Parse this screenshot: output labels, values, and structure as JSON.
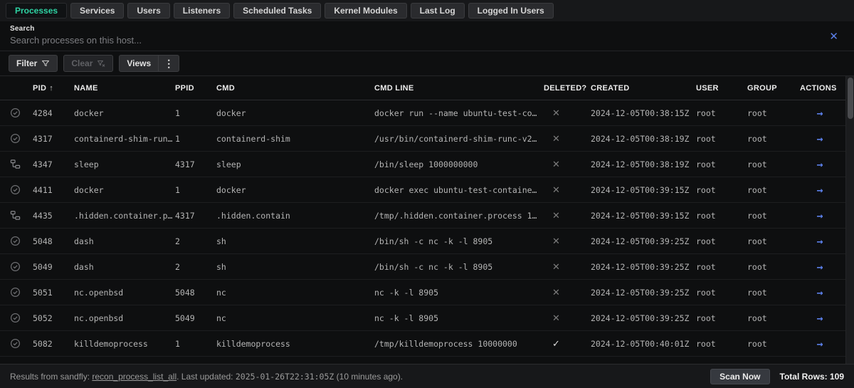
{
  "colors": {
    "accent_teal": "#2ed3a3",
    "accent_blue": "#5b7fe8",
    "background": "#0e0f10"
  },
  "icons": {
    "close": "✕",
    "kebab": "⋮",
    "sort_asc": "↑",
    "deleted_yes": "✓",
    "deleted_no": "✕",
    "row_action": "→"
  },
  "tabs": [
    {
      "label": "Processes",
      "active": true
    },
    {
      "label": "Services",
      "active": false
    },
    {
      "label": "Users",
      "active": false
    },
    {
      "label": "Listeners",
      "active": false
    },
    {
      "label": "Scheduled Tasks",
      "active": false
    },
    {
      "label": "Kernel Modules",
      "active": false
    },
    {
      "label": "Last Log",
      "active": false
    },
    {
      "label": "Logged In Users",
      "active": false
    }
  ],
  "search": {
    "label": "Search",
    "placeholder": "Search processes on this host..."
  },
  "toolbar": {
    "filter": "Filter",
    "clear": "Clear",
    "views": "Views"
  },
  "table": {
    "columns": [
      {
        "label": ""
      },
      {
        "label": "PID",
        "sorted": "asc"
      },
      {
        "label": "NAME"
      },
      {
        "label": "PPID"
      },
      {
        "label": "CMD"
      },
      {
        "label": "CMD LINE"
      },
      {
        "label": "DELETED?"
      },
      {
        "label": "CREATED"
      },
      {
        "label": "USER"
      },
      {
        "label": "GROUP"
      },
      {
        "label": "ACTIONS"
      }
    ],
    "rows": [
      {
        "icon": "verified",
        "pid": "4284",
        "name": "docker",
        "ppid": "1",
        "cmd": "docker",
        "cmd_line": "docker run --name ubuntu-test-co…",
        "deleted": "no",
        "created": "2024-12-05T00:38:15Z",
        "user": "root",
        "group": "root"
      },
      {
        "icon": "verified",
        "pid": "4317",
        "name": "containerd-shim-run…",
        "ppid": "1",
        "cmd": "containerd-shim",
        "cmd_line": "/usr/bin/containerd-shim-runc-v2…",
        "deleted": "no",
        "created": "2024-12-05T00:38:19Z",
        "user": "root",
        "group": "root"
      },
      {
        "icon": "tree",
        "pid": "4347",
        "name": "sleep",
        "ppid": "4317",
        "cmd": "sleep",
        "cmd_line": "/bin/sleep 1000000000",
        "deleted": "no",
        "created": "2024-12-05T00:38:19Z",
        "user": "root",
        "group": "root"
      },
      {
        "icon": "verified",
        "pid": "4411",
        "name": "docker",
        "ppid": "1",
        "cmd": "docker",
        "cmd_line": "docker exec ubuntu-test-containe…",
        "deleted": "no",
        "created": "2024-12-05T00:39:15Z",
        "user": "root",
        "group": "root"
      },
      {
        "icon": "tree",
        "pid": "4435",
        "name": ".hidden.container.p…",
        "ppid": "4317",
        "cmd": ".hidden.contain",
        "cmd_line": "/tmp/.hidden.container.process 1…",
        "deleted": "no",
        "created": "2024-12-05T00:39:15Z",
        "user": "root",
        "group": "root"
      },
      {
        "icon": "verified",
        "pid": "5048",
        "name": "dash",
        "ppid": "2",
        "cmd": "sh",
        "cmd_line": "/bin/sh -c nc -k -l 8905",
        "deleted": "no",
        "created": "2024-12-05T00:39:25Z",
        "user": "root",
        "group": "root"
      },
      {
        "icon": "verified",
        "pid": "5049",
        "name": "dash",
        "ppid": "2",
        "cmd": "sh",
        "cmd_line": "/bin/sh -c nc -k -l 8905",
        "deleted": "no",
        "created": "2024-12-05T00:39:25Z",
        "user": "root",
        "group": "root"
      },
      {
        "icon": "verified",
        "pid": "5051",
        "name": "nc.openbsd",
        "ppid": "5048",
        "cmd": "nc",
        "cmd_line": "nc -k -l 8905",
        "deleted": "no",
        "created": "2024-12-05T00:39:25Z",
        "user": "root",
        "group": "root"
      },
      {
        "icon": "verified",
        "pid": "5052",
        "name": "nc.openbsd",
        "ppid": "5049",
        "cmd": "nc",
        "cmd_line": "nc -k -l 8905",
        "deleted": "no",
        "created": "2024-12-05T00:39:25Z",
        "user": "root",
        "group": "root"
      },
      {
        "icon": "verified",
        "pid": "5082",
        "name": "killdemoprocess",
        "ppid": "1",
        "cmd": "killdemoprocess",
        "cmd_line": "/tmp/killdemoprocess 10000000",
        "deleted": "yes",
        "created": "2024-12-05T00:40:01Z",
        "user": "root",
        "group": "root"
      }
    ]
  },
  "footer": {
    "results_prefix": "Results from sandfly: ",
    "sandfly_name": "recon_process_list_all",
    "updated_label": ". Last updated: ",
    "updated_time": "2025-01-26T22:31:05Z",
    "updated_ago": " (10 minutes ago).",
    "scan_button": "Scan Now",
    "total_label": "Total Rows:",
    "total_value": "109"
  }
}
